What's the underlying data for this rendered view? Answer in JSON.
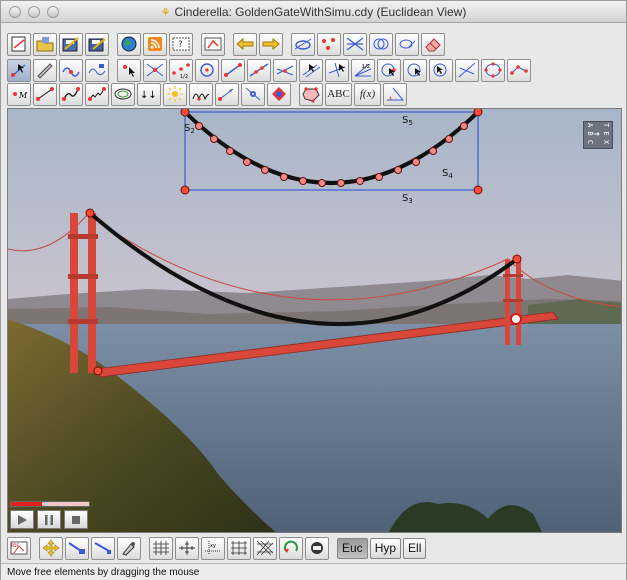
{
  "window": {
    "title": "Cinderella: GoldenGateWithSimu.cdy (Euclidean View)"
  },
  "toolbar": {
    "row1": [
      "new-icon",
      "open-icon",
      "save-icon",
      "save-as-icon",
      "globe-icon",
      "rss-icon",
      "help-icon",
      "measure-icon",
      "undo-arrow-icon",
      "redo-arrow-icon",
      "conic-icon",
      "points-icon",
      "lines-icon",
      "circles-icon",
      "conic-icon",
      "eraser-icon"
    ],
    "row2": [
      "move-icon",
      "pen-icon",
      "circle-path-icon",
      "transform-icon",
      "add-point-icon",
      "intersection-icon",
      "midpoint-icon",
      "circle-icon",
      "segment-icon",
      "line-icon",
      "ray-icon",
      "parallel-icon",
      "perpendicular-icon",
      "angle-bisector-icon",
      "point-on-circle-icon",
      "circle-by-radius-icon",
      "compass-icon",
      "tangent-icon",
      "conic-5p-icon",
      "polygon-icon"
    ],
    "row3_labels": {
      "text_tool": "ABC",
      "function_tool": "f(x)"
    },
    "row3": [
      "mass-icon",
      "spring-icon",
      "rubber-band-icon",
      "bungee-icon",
      "coil-icon",
      "gravity-icon",
      "sun-icon",
      "magnet-icon",
      "velocity-icon",
      "floor-icon",
      "bouncer-icon",
      "text-icon",
      "function-icon",
      "geometry-icon"
    ]
  },
  "canvas": {
    "labels": {
      "s2": "S",
      "s2_sub": "2",
      "s5": "S",
      "s5_sub": "5",
      "s4": "S",
      "s4_sub": "4",
      "s3": "S",
      "s3_sub": "3"
    },
    "info_icon": {
      "left": "A B C",
      "right": "T E X"
    },
    "colors": {
      "rectangle": "#3b5bd6",
      "curve": "#111111",
      "point_fill": "#ff4a3a",
      "tower": "#d9473a"
    }
  },
  "animation": {
    "progress": 0.4
  },
  "bottombar": {
    "geometry_buttons": [
      "Euc",
      "Hyp",
      "Ell"
    ],
    "active_geometry": "Euc"
  },
  "status": {
    "text": "Move free elements by dragging the mouse"
  }
}
